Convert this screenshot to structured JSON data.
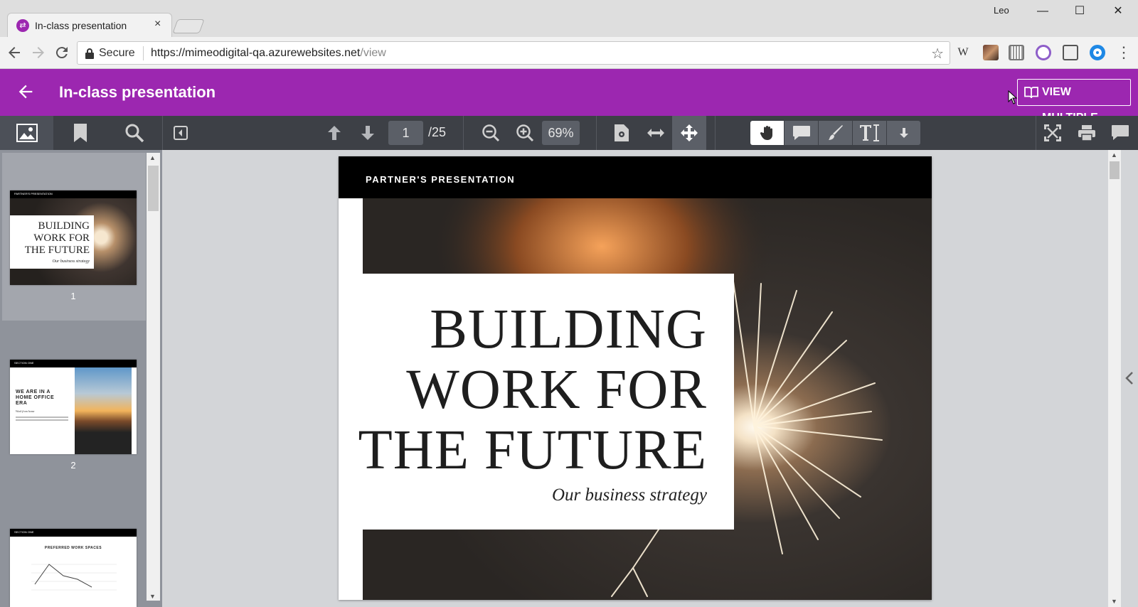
{
  "browser": {
    "tab_title": "In-class presentation",
    "tab_close": "×",
    "profile_name": "Leo",
    "minimize": "—",
    "maximize": "☐",
    "close": "✕",
    "secure_label": "Secure",
    "url_host": "https://mimeodigital-qa.azurewebsites.net",
    "url_path": "/view",
    "extension_w": "W"
  },
  "app": {
    "title": "In-class presentation",
    "view_multiple_label": "VIEW MULTIPLE",
    "accent_color": "#9c27b0"
  },
  "toolbar": {
    "current_page": "1",
    "total_pages": "/25",
    "zoom": "69%"
  },
  "thumbnails": [
    {
      "number": "1",
      "header": "PARTNER'S PRESENTATION",
      "title": "BUILDING WORK FOR THE FUTURE",
      "subtitle": "Our business strategy"
    },
    {
      "number": "2",
      "header": "SECTION ONE",
      "title": "WE ARE IN A HOME OFFICE ERA",
      "subtitle": "Work from home"
    },
    {
      "header": "SECTION ONE",
      "title": "PREFERRED WORK SPACES"
    }
  ],
  "slide": {
    "eyebrow": "PARTNER'S PRESENTATION",
    "title_line1": "BUILDING",
    "title_line2": "WORK FOR",
    "title_line3": "THE FUTURE",
    "subtitle": "Our business strategy"
  }
}
